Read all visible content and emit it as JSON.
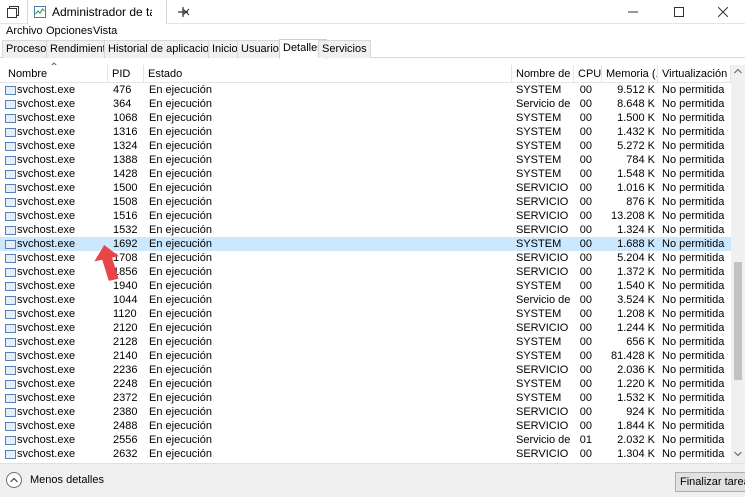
{
  "window": {
    "tab_title": "Administrador de tarea",
    "icons": [
      "tab-overview-icon",
      "task-manager-app-icon",
      "close-tab-icon",
      "new-tab-icon",
      "minimize-icon",
      "maximize-icon",
      "close-icon"
    ]
  },
  "menu": {
    "file": "Archivo",
    "options": "Opciones",
    "view": "Vista"
  },
  "tabs": [
    {
      "label": "Procesos"
    },
    {
      "label": "Rendimiento"
    },
    {
      "label": "Historial de aplicaciones"
    },
    {
      "label": "Inicio"
    },
    {
      "label": "Usuarios"
    },
    {
      "label": "Detalles",
      "active": true
    },
    {
      "label": "Servicios"
    }
  ],
  "columns": {
    "name": "Nombre",
    "pid": "PID",
    "status": "Estado",
    "user": "Nombre de ...",
    "cpu": "CPU",
    "memory": "Memoria (...",
    "virtualization": "Virtualización ..."
  },
  "rows": [
    {
      "name": "svchost.exe",
      "pid": "476",
      "status": "En ejecución",
      "user": "SYSTEM",
      "cpu": "00",
      "memory": "9.512 K",
      "virt": "No permitida"
    },
    {
      "name": "svchost.exe",
      "pid": "364",
      "status": "En ejecución",
      "user": "Servicio de ...",
      "cpu": "00",
      "memory": "8.648 K",
      "virt": "No permitida"
    },
    {
      "name": "svchost.exe",
      "pid": "1068",
      "status": "En ejecución",
      "user": "SYSTEM",
      "cpu": "00",
      "memory": "1.500 K",
      "virt": "No permitida"
    },
    {
      "name": "svchost.exe",
      "pid": "1316",
      "status": "En ejecución",
      "user": "SYSTEM",
      "cpu": "00",
      "memory": "1.432 K",
      "virt": "No permitida"
    },
    {
      "name": "svchost.exe",
      "pid": "1324",
      "status": "En ejecución",
      "user": "SYSTEM",
      "cpu": "00",
      "memory": "5.272 K",
      "virt": "No permitida"
    },
    {
      "name": "svchost.exe",
      "pid": "1388",
      "status": "En ejecución",
      "user": "SYSTEM",
      "cpu": "00",
      "memory": "784 K",
      "virt": "No permitida"
    },
    {
      "name": "svchost.exe",
      "pid": "1428",
      "status": "En ejecución",
      "user": "SYSTEM",
      "cpu": "00",
      "memory": "1.548 K",
      "virt": "No permitida"
    },
    {
      "name": "svchost.exe",
      "pid": "1500",
      "status": "En ejecución",
      "user": "SERVICIO ...",
      "cpu": "00",
      "memory": "1.016 K",
      "virt": "No permitida"
    },
    {
      "name": "svchost.exe",
      "pid": "1508",
      "status": "En ejecución",
      "user": "SERVICIO ...",
      "cpu": "00",
      "memory": "876 K",
      "virt": "No permitida"
    },
    {
      "name": "svchost.exe",
      "pid": "1516",
      "status": "En ejecución",
      "user": "SERVICIO ...",
      "cpu": "00",
      "memory": "13.208 K",
      "virt": "No permitida"
    },
    {
      "name": "svchost.exe",
      "pid": "1532",
      "status": "En ejecución",
      "user": "SERVICIO ...",
      "cpu": "00",
      "memory": "1.324 K",
      "virt": "No permitida"
    },
    {
      "name": "svchost.exe",
      "pid": "1692",
      "status": "En ejecución",
      "user": "SYSTEM",
      "cpu": "00",
      "memory": "1.688 K",
      "virt": "No permitida",
      "selected": true
    },
    {
      "name": "svchost.exe",
      "pid": "1708",
      "status": "En ejecución",
      "user": "SERVICIO ...",
      "cpu": "00",
      "memory": "5.204 K",
      "virt": "No permitida"
    },
    {
      "name": "svchost.exe",
      "pid": "1856",
      "status": "En ejecución",
      "user": "SERVICIO ...",
      "cpu": "00",
      "memory": "1.372 K",
      "virt": "No permitida"
    },
    {
      "name": "svchost.exe",
      "pid": "1940",
      "status": "En ejecución",
      "user": "SYSTEM",
      "cpu": "00",
      "memory": "1.540 K",
      "virt": "No permitida"
    },
    {
      "name": "svchost.exe",
      "pid": "1044",
      "status": "En ejecución",
      "user": "Servicio de ...",
      "cpu": "00",
      "memory": "3.524 K",
      "virt": "No permitida"
    },
    {
      "name": "svchost.exe",
      "pid": "1120",
      "status": "En ejecución",
      "user": "SYSTEM",
      "cpu": "00",
      "memory": "1.208 K",
      "virt": "No permitida"
    },
    {
      "name": "svchost.exe",
      "pid": "2120",
      "status": "En ejecución",
      "user": "SERVICIO ...",
      "cpu": "00",
      "memory": "1.244 K",
      "virt": "No permitida"
    },
    {
      "name": "svchost.exe",
      "pid": "2128",
      "status": "En ejecución",
      "user": "SYSTEM",
      "cpu": "00",
      "memory": "656 K",
      "virt": "No permitida"
    },
    {
      "name": "svchost.exe",
      "pid": "2140",
      "status": "En ejecución",
      "user": "SYSTEM",
      "cpu": "00",
      "memory": "81.428 K",
      "virt": "No permitida"
    },
    {
      "name": "svchost.exe",
      "pid": "2236",
      "status": "En ejecución",
      "user": "SERVICIO ...",
      "cpu": "00",
      "memory": "2.036 K",
      "virt": "No permitida"
    },
    {
      "name": "svchost.exe",
      "pid": "2248",
      "status": "En ejecución",
      "user": "SYSTEM",
      "cpu": "00",
      "memory": "1.220 K",
      "virt": "No permitida"
    },
    {
      "name": "svchost.exe",
      "pid": "2372",
      "status": "En ejecución",
      "user": "SYSTEM",
      "cpu": "00",
      "memory": "1.532 K",
      "virt": "No permitida"
    },
    {
      "name": "svchost.exe",
      "pid": "2380",
      "status": "En ejecución",
      "user": "SERVICIO ...",
      "cpu": "00",
      "memory": "924 K",
      "virt": "No permitida"
    },
    {
      "name": "svchost.exe",
      "pid": "2488",
      "status": "En ejecución",
      "user": "SERVICIO ...",
      "cpu": "00",
      "memory": "1.844 K",
      "virt": "No permitida"
    },
    {
      "name": "svchost.exe",
      "pid": "2556",
      "status": "En ejecución",
      "user": "Servicio de ...",
      "cpu": "01",
      "memory": "2.032 K",
      "virt": "No permitida"
    },
    {
      "name": "svchost.exe",
      "pid": "2632",
      "status": "En ejecución",
      "user": "SERVICIO ...",
      "cpu": "00",
      "memory": "1.304 K",
      "virt": "No permitida"
    }
  ],
  "footer": {
    "less_details": "Menos detalles",
    "end_task": "Finalizar tarea"
  },
  "colors": {
    "selected_row": "#cce8ff",
    "annotation_arrow": "#e8454b"
  }
}
